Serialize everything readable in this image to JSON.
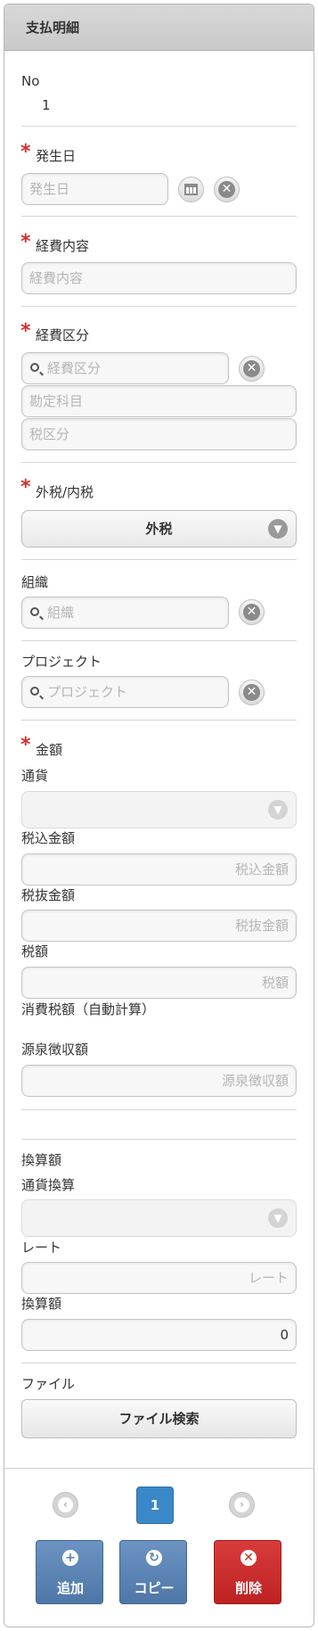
{
  "header": {
    "title": "支払明細"
  },
  "no": {
    "label": "No",
    "value": "1"
  },
  "required_mark": "*",
  "occurrence_date": {
    "label": "発生日",
    "placeholder": "発生日"
  },
  "expense_content": {
    "label": "経費内容",
    "placeholder": "経費内容"
  },
  "expense_category": {
    "label": "経費区分",
    "placeholder": "経費区分",
    "account_placeholder": "勘定科目",
    "tax_category_placeholder": "税区分"
  },
  "tax_type": {
    "label": "外税/内税",
    "selected": "外税"
  },
  "organization": {
    "label": "組織",
    "placeholder": "組織"
  },
  "project": {
    "label": "プロジェクト",
    "placeholder": "プロジェクト"
  },
  "amount": {
    "label": "金額",
    "currency_label": "通貨",
    "tax_included_label": "税込金額",
    "tax_included_placeholder": "税込金額",
    "tax_excluded_label": "税抜金額",
    "tax_excluded_placeholder": "税抜金額",
    "tax_label": "税額",
    "tax_placeholder": "税額",
    "consumption_tax_label": "消費税額（自動計算）",
    "withholding_label": "源泉徴収額",
    "withholding_placeholder": "源泉徴収額"
  },
  "conversion": {
    "section_label": "換算額",
    "currency_conversion_label": "通貨換算",
    "rate_label": "レート",
    "rate_placeholder": "レート",
    "converted_label": "換算額",
    "converted_value": "0"
  },
  "file": {
    "label": "ファイル",
    "search_button": "ファイル検索"
  },
  "pager": {
    "current_page": "1"
  },
  "actions": {
    "add": "追加",
    "copy": "コピー",
    "delete": "削除"
  },
  "colors": {
    "accent_blue": "#3a88c8",
    "action_blue": "#5b83b3",
    "delete_red": "#cc2b2b",
    "required_red": "#d62f2f"
  }
}
